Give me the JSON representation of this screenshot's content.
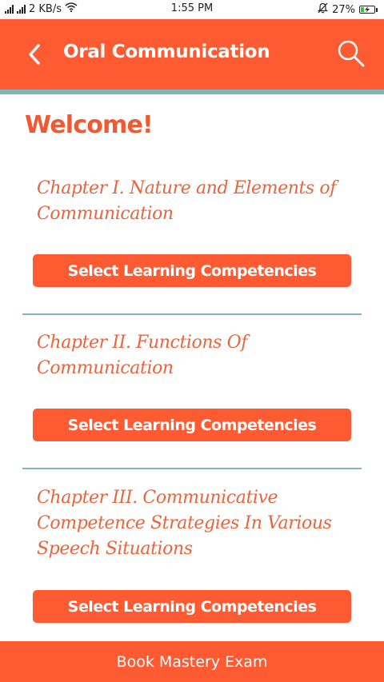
{
  "status_bar": {
    "network_speed": "2 KB/s",
    "time": "1:55 PM",
    "battery_percent": "27%",
    "battery_level": 0.27,
    "icons": [
      "signal-icon",
      "signal-icon",
      "wifi-icon",
      "bell-muted-icon",
      "battery-charging-icon"
    ]
  },
  "app_bar": {
    "title": "Oral Communication",
    "back_icon": "chevron-left-icon",
    "search_icon": "search-icon"
  },
  "main": {
    "heading": "Welcome!",
    "chapters": [
      {
        "title": "Chapter I. Nature and Elements of Communication",
        "button_label": "Select Learning Competencies"
      },
      {
        "title": "Chapter II. Functions Of Communication",
        "button_label": "Select Learning Competencies"
      },
      {
        "title": "Chapter III. Communicative Competence Strategies In Various Speech Situations",
        "button_label": "Select Learning Competencies"
      }
    ]
  },
  "bottom_bar": {
    "label": "Book Mastery Exam"
  },
  "colors": {
    "accent": "#ff5b33",
    "heading": "#ef5a35",
    "chapter_text": "#e8653d",
    "divider": "#7fb7bf",
    "battery_fill": "#3cbf3c"
  }
}
